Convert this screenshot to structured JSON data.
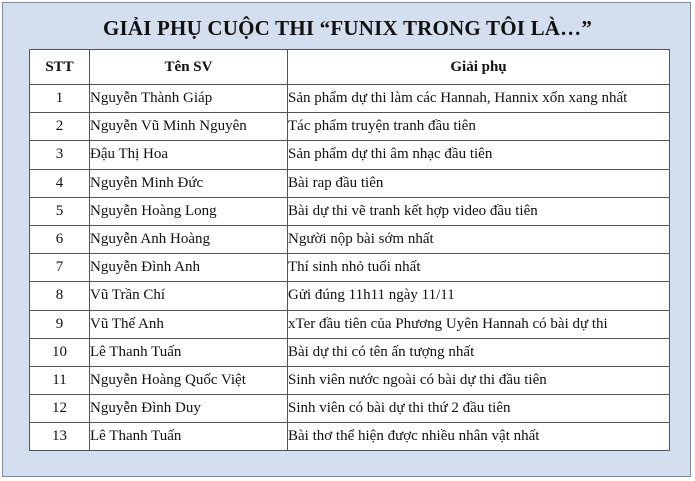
{
  "title": "GIẢI PHỤ CUỘC THI “FUNIX TRONG TÔI LÀ…”",
  "table": {
    "headers": [
      "STT",
      "Tên SV",
      "Giải phụ"
    ],
    "rows": [
      {
        "stt": "1",
        "name": "Nguyễn Thành Giáp",
        "prize": "Sản phẩm dự thi làm các Hannah, Hannix xốn xang nhất"
      },
      {
        "stt": "2",
        "name": "Nguyễn Vũ Minh Nguyên",
        "prize": "Tác phẩm truyện tranh đầu tiên"
      },
      {
        "stt": "3",
        "name": "Đậu Thị Hoa",
        "prize": "Sản phẩm dự thi âm nhạc đầu tiên"
      },
      {
        "stt": "4",
        "name": "Nguyễn Minh Đức",
        "prize": "Bài rap đầu tiên"
      },
      {
        "stt": "5",
        "name": "Nguyễn Hoàng Long",
        "prize": "Bài dự thi vẽ tranh kết hợp video đầu tiên"
      },
      {
        "stt": "6",
        "name": "Nguyễn Anh Hoàng",
        "prize": "Người nộp bài sớm nhất"
      },
      {
        "stt": "7",
        "name": "Nguyễn Đình Anh",
        "prize": "Thí sinh nhỏ tuổi nhất"
      },
      {
        "stt": "8",
        "name": "Vũ Trần Chí",
        "prize": "Gửi đúng 11h11 ngày 11/11"
      },
      {
        "stt": "9",
        "name": "Vũ Thế Anh",
        "prize": "xTer đầu tiên của Phương Uyên Hannah có bài dự thi"
      },
      {
        "stt": "10",
        "name": "Lê Thanh Tuấn",
        "prize": "Bài dự thi có tên ấn tượng nhất"
      },
      {
        "stt": "11",
        "name": "Nguyễn Hoàng Quốc Việt",
        "prize": "Sinh viên nước ngoài có bài dự thi đầu tiên"
      },
      {
        "stt": "12",
        "name": "Nguyễn Đình Duy",
        "prize": "Sinh viên có bài dự thi thứ 2 đầu tiên"
      },
      {
        "stt": "13",
        "name": "Lê Thanh Tuấn",
        "prize": "Bài thơ thể hiện được nhiều nhân vật nhất"
      }
    ]
  },
  "colors": {
    "frame_background": "#d3dfee",
    "frame_border": "#7a8ea3",
    "table_background": "#ffffff",
    "grid_line": "#555555"
  }
}
